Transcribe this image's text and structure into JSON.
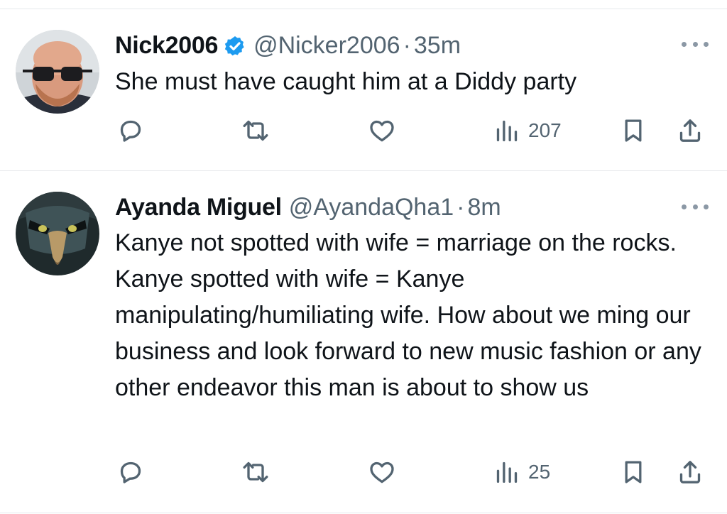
{
  "tweets": [
    {
      "display_name": "Nick2006",
      "verified": true,
      "handle": "@Nicker2006",
      "separator": "·",
      "time": "35m",
      "text": "She must have caught him at a Diddy party",
      "views": "207",
      "avatar": "bald-man-sunglasses-avatar"
    },
    {
      "display_name": "Ayanda Miguel",
      "verified": false,
      "handle": "@AyandaQha1",
      "separator": "·",
      "time": "8m",
      "text": "Kanye not spotted with wife = marriage on the rocks. Kanye spotted with wife = Kanye manipulating/humiliating wife. How about we ming our business and look forward to new music fashion or any other endeavor this man is about to show us",
      "views": "25",
      "avatar": "eagle-avatar"
    }
  ],
  "icons": {
    "reply": "reply-icon",
    "repost": "repost-icon",
    "like": "like-icon",
    "views": "views-icon",
    "bookmark": "bookmark-icon",
    "share": "share-icon",
    "more": "more-icon",
    "verified": "verified-badge-icon"
  },
  "colors": {
    "text": "#0f1419",
    "secondary": "#536471",
    "icon": "#536471",
    "verified": "#1d9bf0",
    "divider": "#e6e9ec"
  }
}
